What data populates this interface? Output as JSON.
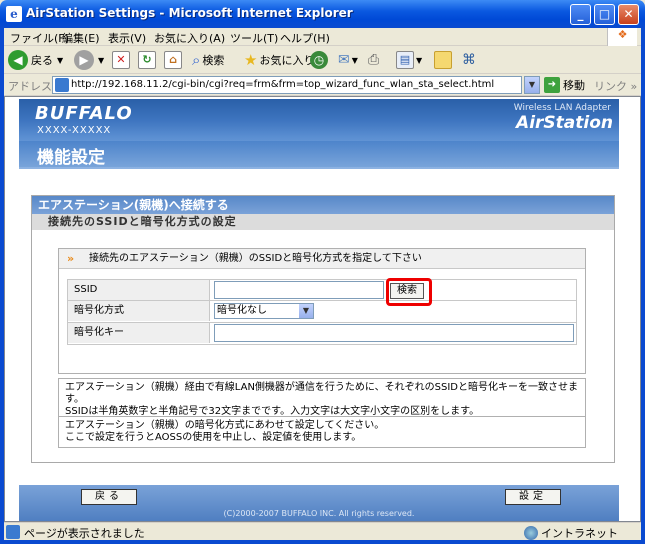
{
  "window": {
    "title": "AirStation Settings - Microsoft Internet Explorer",
    "min": "_",
    "max": "□",
    "close": "✕"
  },
  "menu": [
    "ファイル(F)",
    "編集(E)",
    "表示(V)",
    "お気に入り(A)",
    "ツール(T)",
    "ヘルプ(H)"
  ],
  "toolbar": {
    "back": "戻る",
    "search": "検索",
    "favorites": "お気に入り"
  },
  "address": {
    "label": "アドレス(D)",
    "url": "http://192.168.11.2/cgi-bin/cgi?req=frm&frm=top_wizard_func_wlan_sta_select.html",
    "go": "移動",
    "links": "リンク"
  },
  "banner": {
    "brand": "BUFFALO",
    "model": "XXXX-XXXXX",
    "tagline": "Wireless LAN Adapter",
    "product": "AirStation",
    "page_title": "機能設定"
  },
  "section": {
    "title": "エアステーション(親機)へ接続する",
    "subtitle": "接続先のSSIDと暗号化方式の設定",
    "hint": "接続先のエアステーション（親機）のSSIDと暗号化方式を指定して下さい"
  },
  "form": {
    "ssid_label": "SSID",
    "ssid_value": "",
    "search_button": "検索",
    "enc_label": "暗号化方式",
    "enc_value": "暗号化なし",
    "key_label": "暗号化キー",
    "key_value": ""
  },
  "notes": {
    "n1_line1": "エアステーション（親機）経由で有線LAN側機器が通信を行うために、それぞれのSSIDと暗号化キーを一致させます。",
    "n1_line2": "SSIDは半角英数字と半角記号で32文字までです。入力文字は大文字小文字の区別をします。",
    "n2_line1": "エアステーション（親機）の暗号化方式にあわせて設定してください。",
    "n2_line2": "ここで設定を行うとAOSSの使用を中止し、設定値を使用します。"
  },
  "footer": {
    "back_button": "戻る",
    "confirm_button": "設定",
    "copyright": "(C)2000-2007 BUFFALO INC. All rights reserved."
  },
  "status": {
    "text": "ページが表示されました",
    "zone": "イントラネット"
  }
}
